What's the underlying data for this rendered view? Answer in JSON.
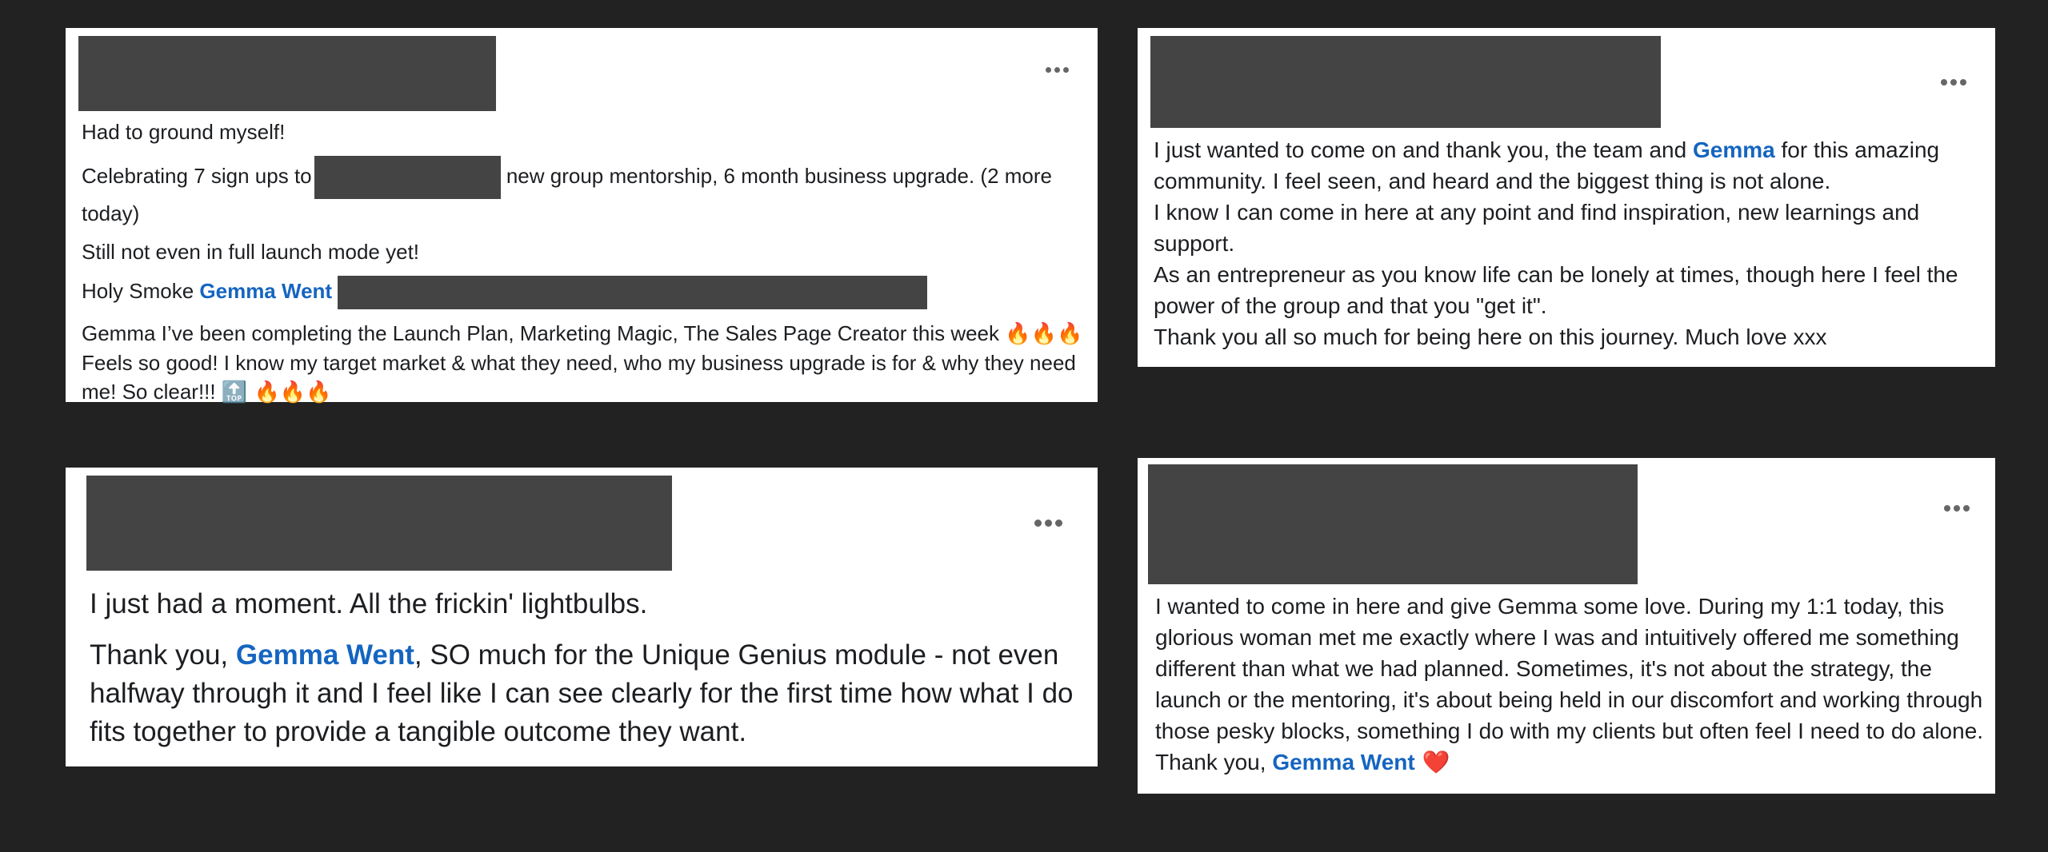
{
  "posts": [
    {
      "paragraphs": {
        "p1": "Had to ground myself!",
        "p2_before": "Celebrating 7 sign ups to",
        "p2_after": " new group mentorship, 6 month business upgrade.  (2 more today)",
        "p3": "Still not even in full launch mode yet!",
        "p4_before": "Holy Smoke ",
        "p4_mention": "Gemma Went",
        "p5_text": "Gemma I’ve been completing the Launch Plan, Marketing Magic, The Sales Page Creator this week ",
        "p5_emoji_1": "🔥🔥🔥",
        "p5_text_2": " Feels so good! I know my target market & what they need, who my business upgrade is for & why they need me! So clear!!! ",
        "p5_emoji_2": "🔝 🔥🔥🔥"
      },
      "more_icon": "more-horizontal-icon"
    },
    {
      "paragraphs": {
        "l1_before": "I just wanted to come on and thank you, the team and ",
        "l1_mention": "Gemma",
        "l1_after": " for this amazing community. I feel seen, and heard and the biggest thing is not alone.",
        "l2": "I know I can come in here at any point and find inspiration, new learnings and support.",
        "l3": "As an entrepreneur as you know life can be lonely at times, though here I feel the power of the group and that you \"get it\".",
        "l4": "Thank you all so much for being here on this journey. Much love xxx"
      },
      "more_icon": "more-horizontal-icon"
    },
    {
      "paragraphs": {
        "p1": "I just had a moment.  All the frickin' lightbulbs.",
        "p2_before": "Thank you, ",
        "p2_mention": "Gemma Went",
        "p2_after": ", SO much for the Unique Genius module - not even halfway through it and I feel like I can see clearly for the first time how what I do fits together to provide a tangible outcome they want."
      },
      "more_icon": "more-horizontal-icon"
    },
    {
      "paragraphs": {
        "p1_before": "I wanted to come in here and give Gemma some love. During my 1:1 today, this glorious woman met me exactly where I was and intuitively offered me something different than what we had planned. Sometimes, it's not about the strategy, the launch or the mentoring, it's about being held in our discomfort and working through those pesky blocks, something I do with my clients but often feel I need to do alone. Thank you, ",
        "p1_mention": "Gemma Went",
        "p1_heart": " ❤️"
      },
      "more_icon": "more-horizontal-icon"
    }
  ],
  "colors": {
    "background": "#222222",
    "card": "#ffffff",
    "redaction": "#444444",
    "mention": "#1565c0"
  }
}
